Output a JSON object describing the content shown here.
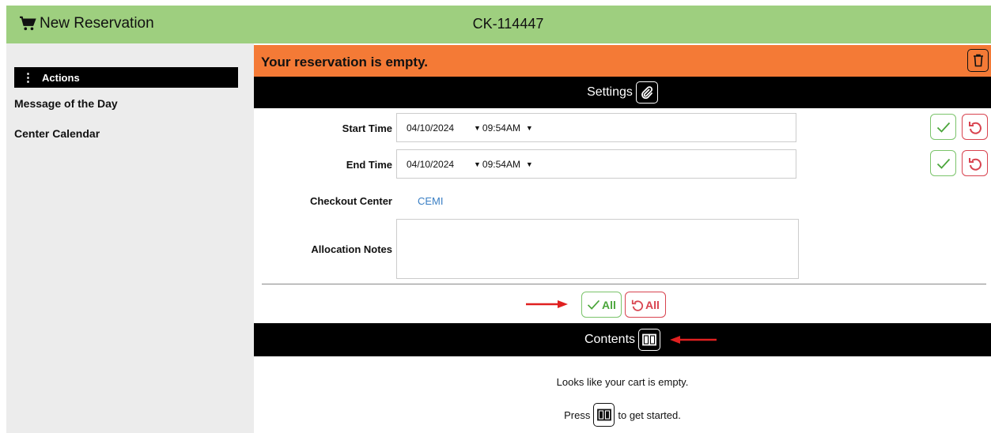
{
  "header": {
    "title": "New Reservation",
    "code": "CK-114447",
    "bg_color": "#9ecf7f"
  },
  "sidebar": {
    "actions_label": "Actions",
    "links": [
      "Message of the Day",
      "Center Calendar"
    ]
  },
  "alert": {
    "text": "Your reservation is empty.",
    "color": "#f47a36"
  },
  "settings": {
    "title": "Settings",
    "start_time": {
      "label": "Start Time",
      "date": "04/10/2024",
      "time": "09:54AM"
    },
    "end_time": {
      "label": "End Time",
      "date": "04/10/2024",
      "time": "09:54AM"
    },
    "checkout_center": {
      "label": "Checkout Center",
      "value": "CEMI"
    },
    "allocation_notes": {
      "label": "Allocation Notes",
      "value": ""
    },
    "apply_all_label": "All",
    "revert_all_label": "All"
  },
  "contents": {
    "title": "Contents",
    "empty_message": "Looks like your cart is empty.",
    "press_prefix": "Press",
    "press_suffix": "to get started."
  },
  "icons": {
    "cart": "cart-icon",
    "trash": "trash-icon",
    "paperclip": "paperclip-icon",
    "check": "check-icon",
    "undo": "undo-icon",
    "book": "book-icon",
    "annotation_arrow": "red-arrow"
  },
  "colors": {
    "confirm": "#4aa53a",
    "revert": "#d8434f",
    "link": "#3a7fc4",
    "annotation": "#e02020"
  }
}
